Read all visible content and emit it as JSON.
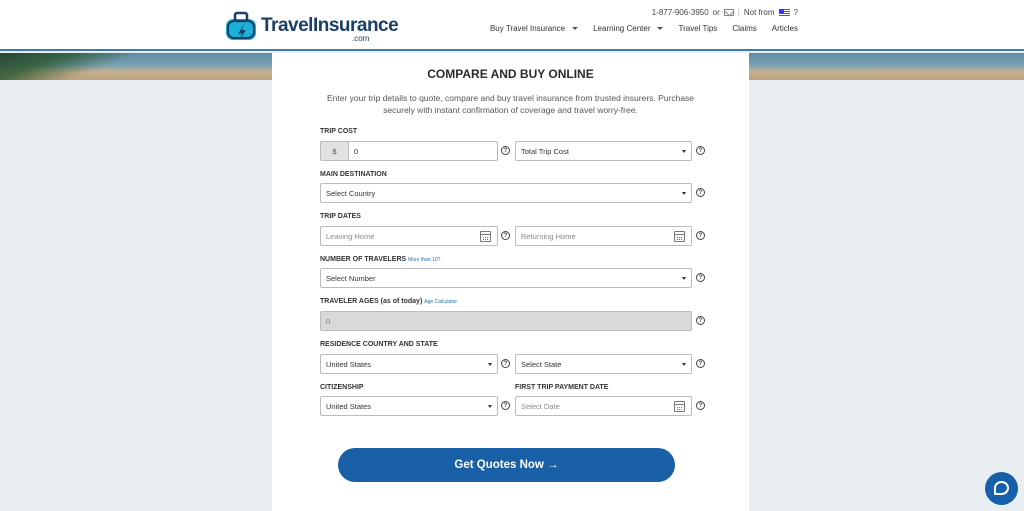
{
  "header": {
    "logo_text_travel": "Travel",
    "logo_text_insurance": "Insurance",
    "logo_com": ".com",
    "phone": "1-877-906-3950",
    "or": "or",
    "separator": "|",
    "not_from": "Not from",
    "question": "?",
    "nav": [
      {
        "label": "Buy Travel Insurance",
        "dropdown": true
      },
      {
        "label": "Learning Center",
        "dropdown": true
      },
      {
        "label": "Travel Tips",
        "dropdown": false
      },
      {
        "label": "Claims",
        "dropdown": false
      },
      {
        "label": "Articles",
        "dropdown": false
      }
    ]
  },
  "form": {
    "title": "COMPARE AND BUY ONLINE",
    "intro": "Enter your trip details to quote, compare and buy travel insurance from trusted insurers. Purchase securely with instant confirmation of coverage and travel worry-free.",
    "trip_cost": {
      "label": "TRIP COST",
      "currency": "$",
      "value": "0",
      "type_select": "Total Trip Cost"
    },
    "destination": {
      "label": "MAIN DESTINATION",
      "select": "Select Country"
    },
    "dates": {
      "label": "TRIP DATES",
      "leaving_placeholder": "Leaving Home",
      "returning_placeholder": "Returning Home"
    },
    "travelers": {
      "label": "NUMBER OF TRAVELERS",
      "link": "More than 10?",
      "select": "Select Number"
    },
    "ages": {
      "label": "TRAVELER AGES (as of today)",
      "link": "Age Calculator",
      "value": "0"
    },
    "residence": {
      "label": "RESIDENCE COUNTRY AND STATE",
      "country": "United States",
      "state": "Select State"
    },
    "citizenship": {
      "label": "CITIZENSHIP",
      "value": "United States"
    },
    "payment": {
      "label": "FIRST TRIP PAYMENT DATE",
      "placeholder": "Select Date"
    },
    "help_glyph": "?",
    "submit": "Get Quotes Now →"
  },
  "colors": {
    "accent": "#1960a6",
    "brand": "#1a3f66",
    "header_border": "#3f7aa8"
  }
}
